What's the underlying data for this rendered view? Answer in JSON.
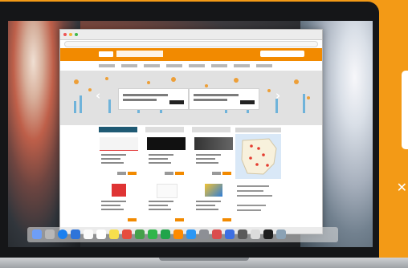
{
  "screen": {
    "background": "#f39a16",
    "accent": "#f28a00",
    "browser_title": "",
    "hero_arrow_left": "‹",
    "hero_arrow_right": "›",
    "close_mark": "✕"
  },
  "icons": {
    "browser_controls": [
      "close-icon",
      "minimize-icon",
      "maximize-icon"
    ],
    "dock": [
      "finder-icon",
      "launchpad-icon",
      "safari-icon",
      "mail-icon",
      "photos-icon",
      "calendar-icon",
      "notes-icon",
      "music-icon",
      "maps-icon",
      "messages-icon",
      "facetime-icon",
      "books-icon",
      "app-store-icon",
      "settings-icon",
      "trash-icon"
    ]
  }
}
